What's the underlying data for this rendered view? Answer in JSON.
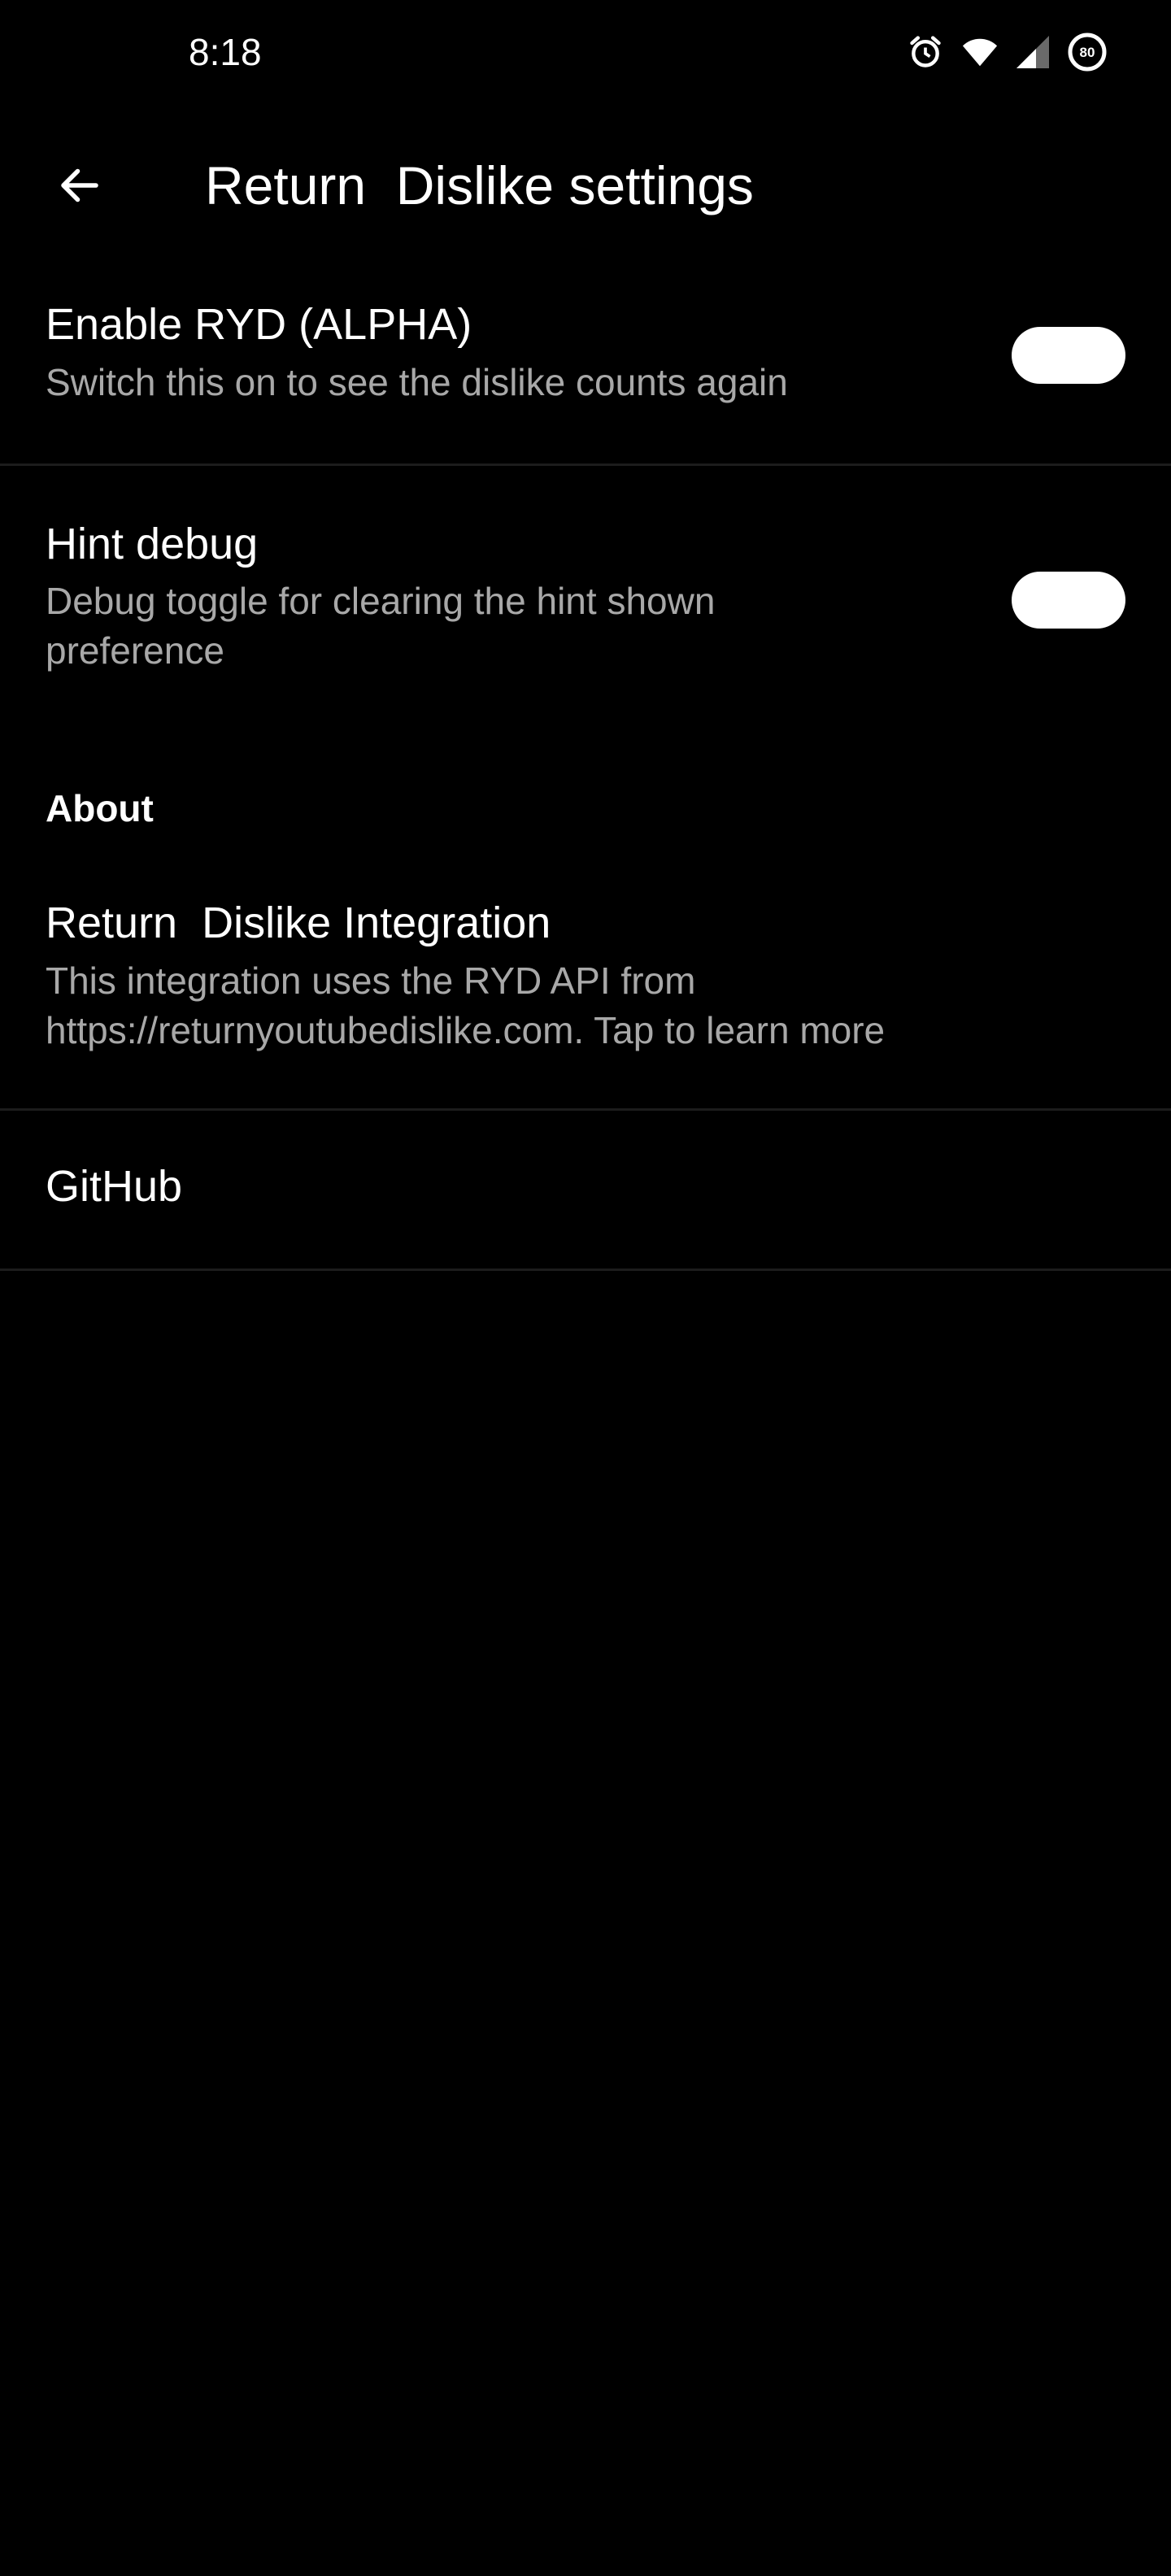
{
  "status_bar": {
    "time": "8:18",
    "icons": [
      "alarm-icon",
      "wifi-icon",
      "signal-icon",
      "battery-saver-icon"
    ],
    "battery_level": "80"
  },
  "app_bar": {
    "back_icon": "arrow-back-icon",
    "title": "Return  Dislike settings"
  },
  "preferences": [
    {
      "title": "Enable RYD (ALPHA)",
      "summary": "Switch this on to see the dislike counts again",
      "toggle": true
    },
    {
      "title": "Hint debug",
      "summary": "Debug toggle for clearing the hint shown\npreference",
      "toggle": true
    }
  ],
  "about": {
    "category_title": "About",
    "items": [
      {
        "title": "Return  Dislike Integration",
        "summary": "This integration uses the RYD API from\nhttps://returnyoutubedislike.com. Tap to learn more"
      },
      {
        "title": "GitHub"
      }
    ]
  },
  "colors": {
    "background": "#000000",
    "text_primary": "#ffffff",
    "text_secondary": "#a8a8a8",
    "divider": "#1c1c1c",
    "switch_track": "#ffffff"
  }
}
